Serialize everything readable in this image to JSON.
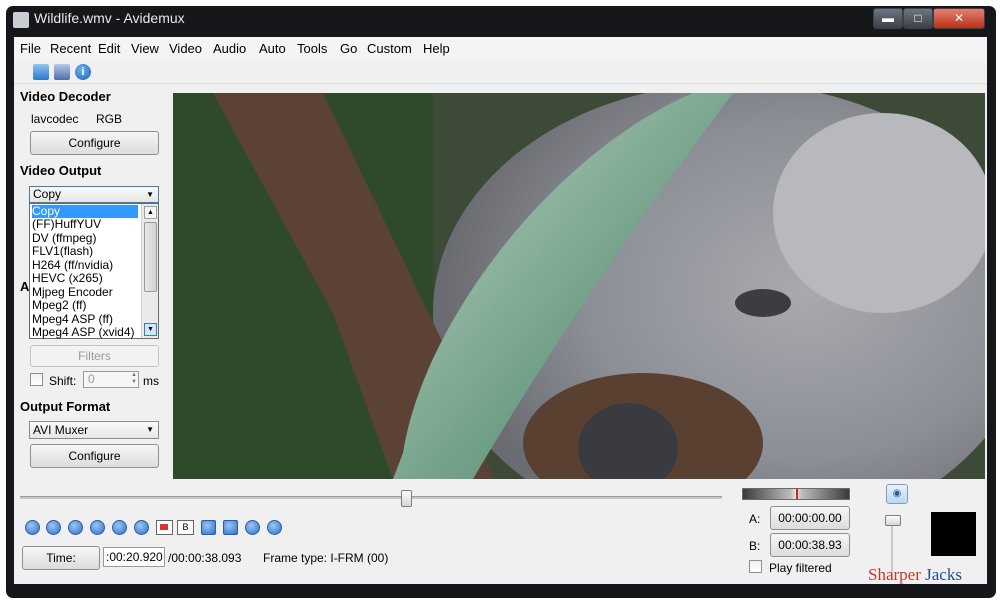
{
  "window": {
    "title": "Wildlife.wmv - Avidemux",
    "minimize_glyph": "▬",
    "maximize_glyph": "□",
    "close_glyph": "✕"
  },
  "menu": [
    "File",
    "Recent",
    "Edit",
    "View",
    "Video",
    "Audio",
    "Auto",
    "Tools",
    "Go",
    "Custom",
    "Help"
  ],
  "toolbar": {
    "icons": [
      "open-folder-icon",
      "save-icon",
      "info-icon"
    ]
  },
  "video_decoder": {
    "header": "Video Decoder",
    "codec": "lavcodec",
    "colorspace": "RGB",
    "configure_label": "Configure"
  },
  "video_output": {
    "header": "Video Output",
    "selected": "Copy",
    "options": [
      "Copy",
      "(FF)HuffYUV",
      "DV (ffmpeg)",
      "FLV1(flash)",
      "H264 (ff/nvidia)",
      "HEVC (x265)",
      "Mjpeg Encoder",
      "Mpeg2 (ff)",
      "Mpeg4 ASP (ff)",
      "Mpeg4 ASP (xvid4)"
    ]
  },
  "audio_output": {
    "header_fragment": "A",
    "filters_label": "Filters",
    "shift_label": "Shift:",
    "shift_value": "0",
    "shift_unit": "ms"
  },
  "output_format": {
    "header": "Output Format",
    "selected": "AVI Muxer",
    "configure_label": "Configure"
  },
  "playback": {
    "position_fraction": 0.55,
    "time_button": "Time:",
    "current_time": ":00:20.920",
    "total_time": "/00:00:38.093",
    "frame_type": "Frame type: I-FRM (00)"
  },
  "markers": {
    "a_label": "A:",
    "a_value": "00:00:00.00",
    "b_label": "B:",
    "b_value": "00:00:38.93",
    "play_filtered": "Play filtered"
  },
  "watermark": {
    "part1": "Sharper",
    "part2": "Jacks"
  },
  "colors": {
    "accent": "#3399ff",
    "titlebar": "#15171b",
    "watermark_red": "#c0392b",
    "watermark_blue": "#1f4e8c"
  }
}
